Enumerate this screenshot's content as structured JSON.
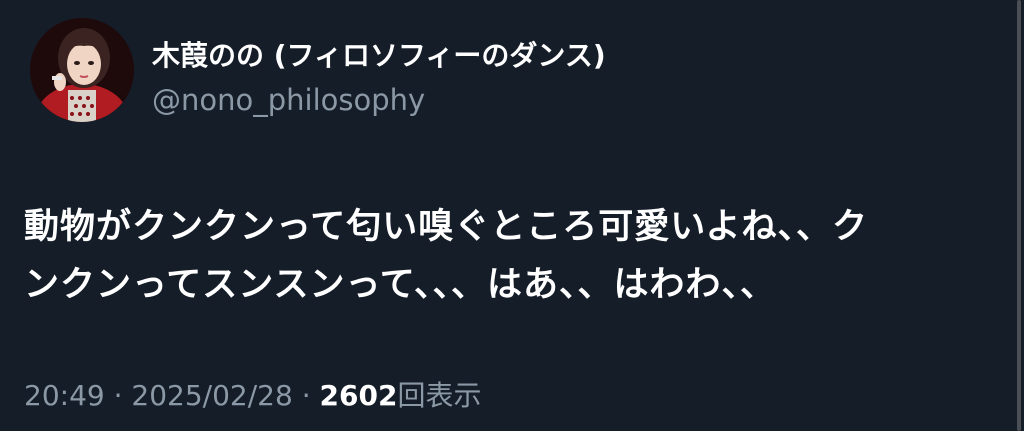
{
  "tweet": {
    "author": {
      "display_name": "木葭のの (フィロソフィーのダンス)",
      "handle": "@nono_philosophy",
      "avatar_icon": "profile-photo"
    },
    "text_line1": "動物がクンクンって匂い嗅ぐところ可愛いよね、、ク",
    "text_line2": "ンクンってスンスンって、、、はあ、、はわわ、、",
    "meta": {
      "time": "20:49",
      "separator": "·",
      "date": "2025/02/28",
      "views_count": "2602",
      "views_label": "回表示"
    }
  },
  "colors": {
    "background": "#151d29",
    "primary_text": "#ffffff",
    "secondary_text": "#8b98a5"
  }
}
